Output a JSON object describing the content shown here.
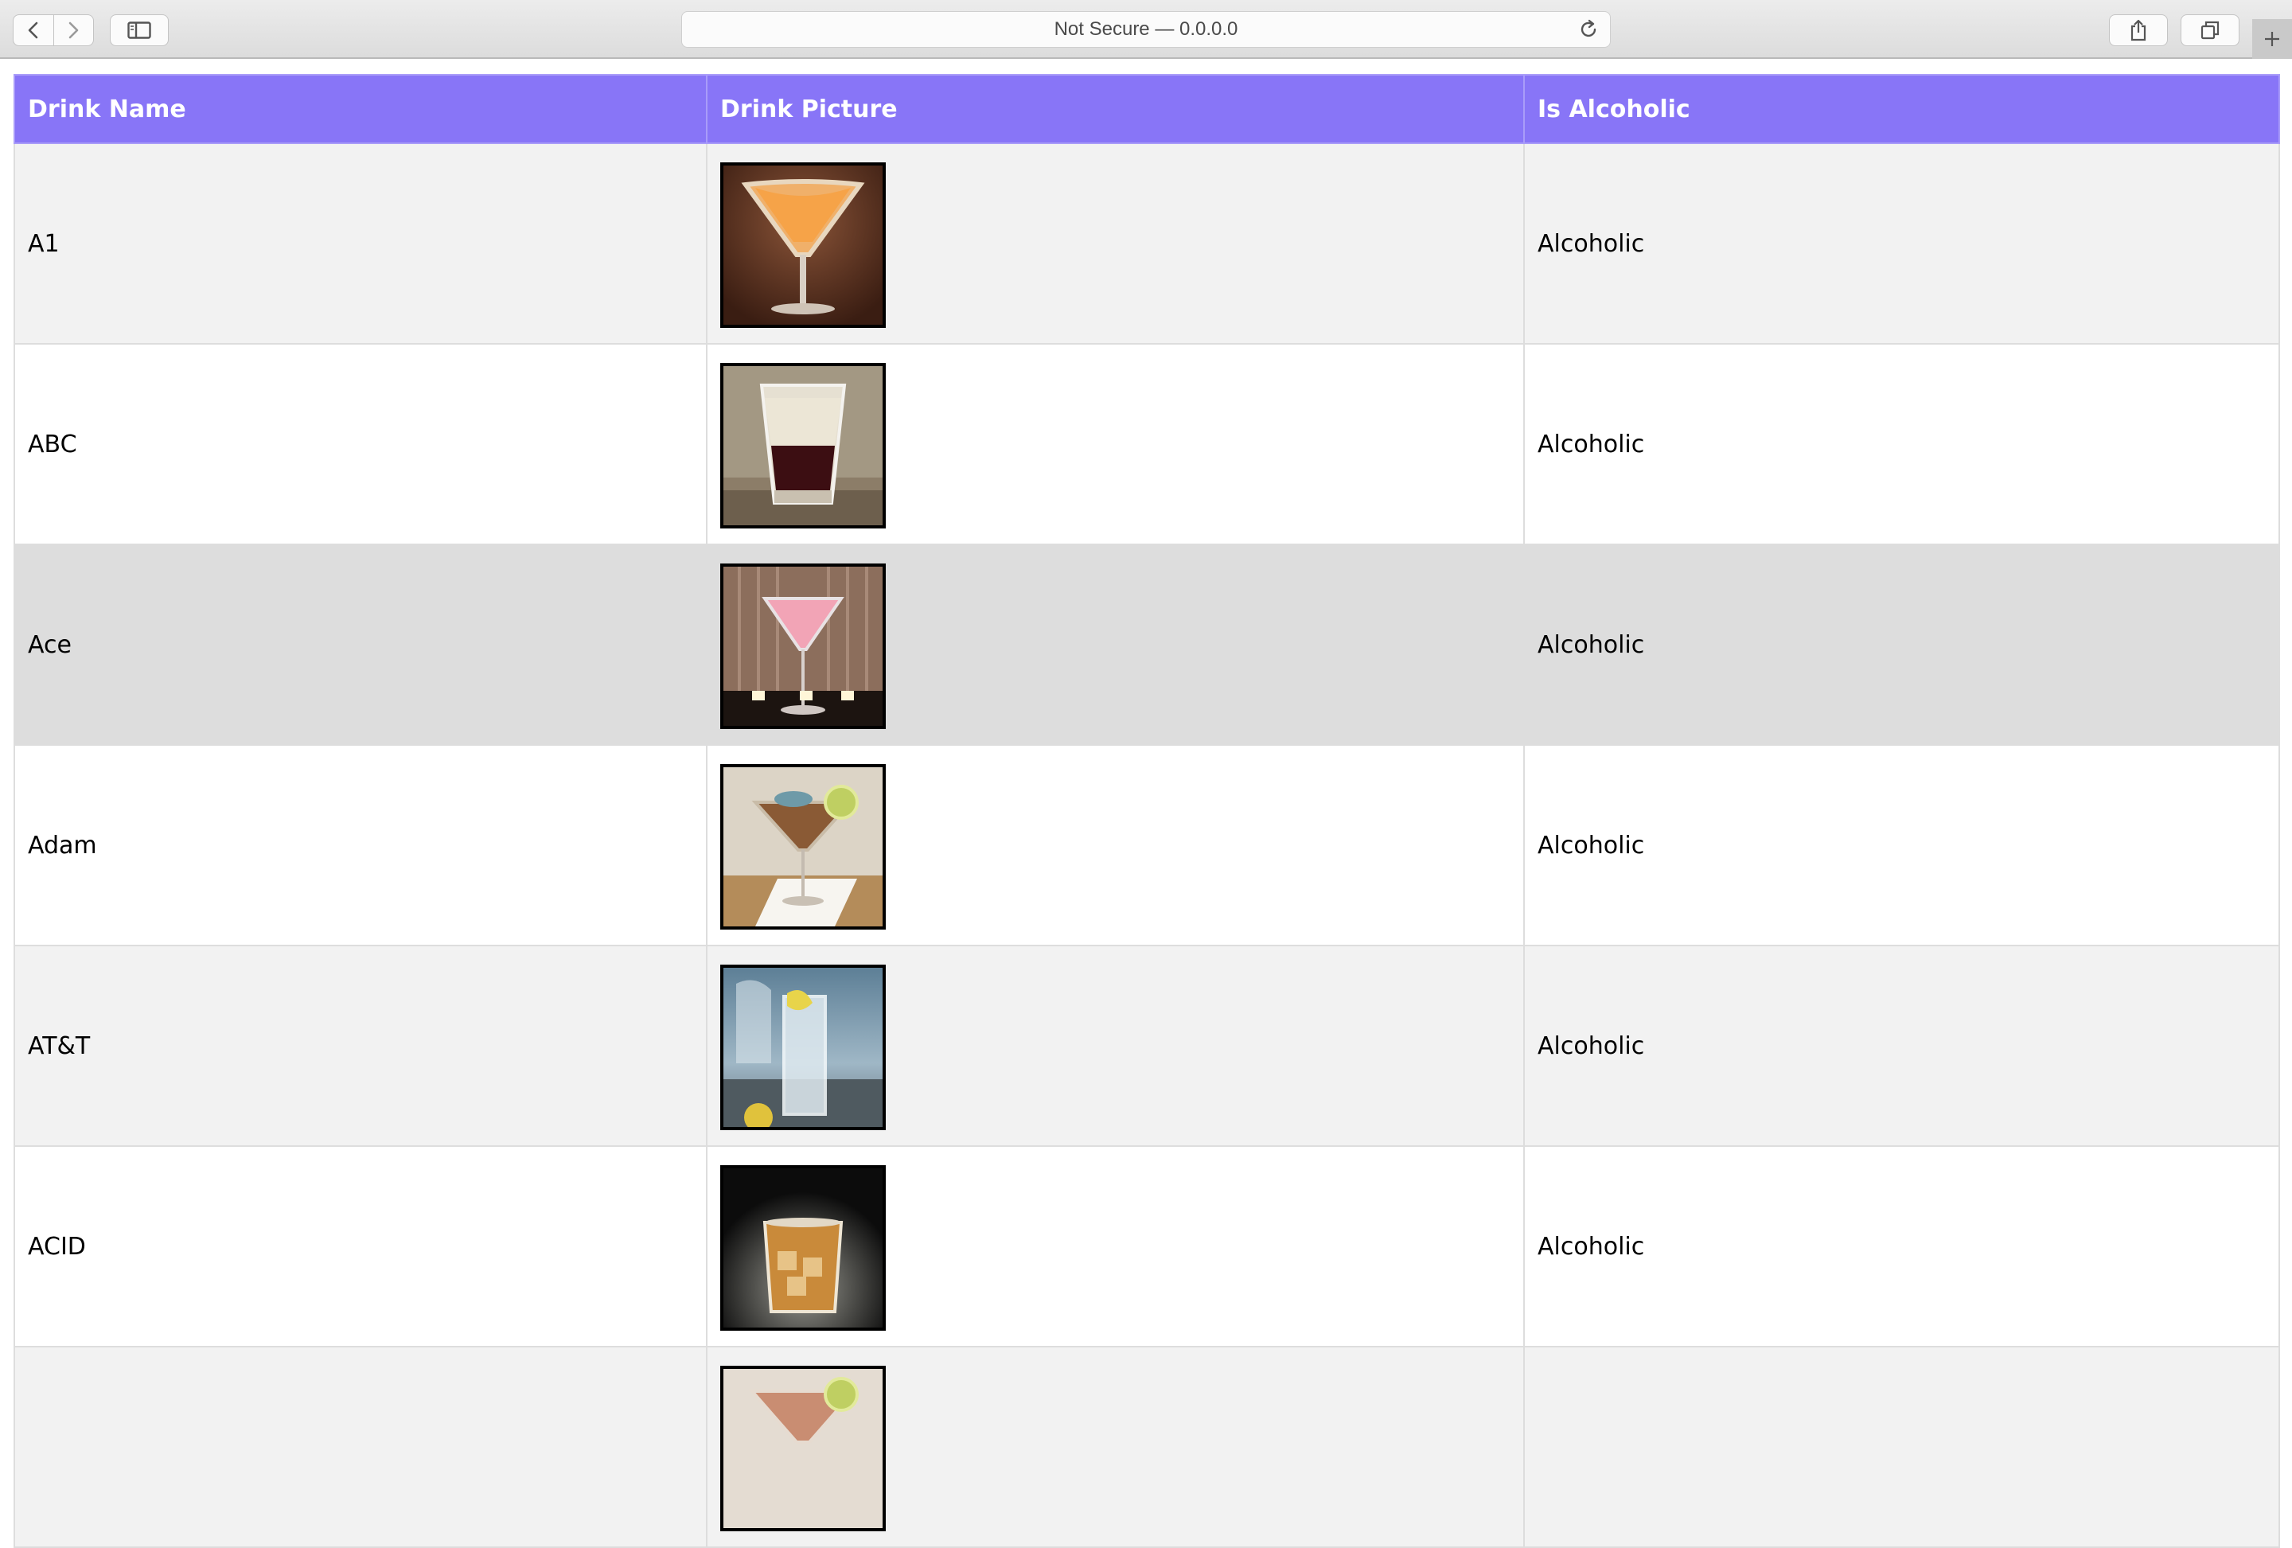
{
  "browser": {
    "address_text": "Not Secure — 0.0.0.0",
    "buttons": [
      "back-icon",
      "forward-icon",
      "sidebar-icon",
      "reload-icon",
      "share-icon",
      "tabs-icon",
      "plus-icon"
    ]
  },
  "table": {
    "header_color": "#8875f7",
    "columns": [
      "Drink Name",
      "Drink Picture",
      "Is Alcoholic"
    ],
    "rows": [
      {
        "name": "A1",
        "picture": "orange martini glass with sugared rim",
        "status": "Alcoholic"
      },
      {
        "name": "ABC",
        "picture": "layered shot glass, cream over dark liquor",
        "status": "Alcoholic"
      },
      {
        "name": "Ace",
        "picture": "pink martini with candles",
        "status": "Alcoholic"
      },
      {
        "name": "Adam",
        "picture": "brown martini with lime wheel",
        "status": "Alcoholic"
      },
      {
        "name": "AT&T",
        "picture": "tall clear glass with lemon",
        "status": "Alcoholic"
      },
      {
        "name": "ACID",
        "picture": "whiskey on the rocks",
        "status": "Alcoholic"
      },
      {
        "name": "",
        "picture": "martini with lime wheel",
        "status": ""
      }
    ]
  }
}
